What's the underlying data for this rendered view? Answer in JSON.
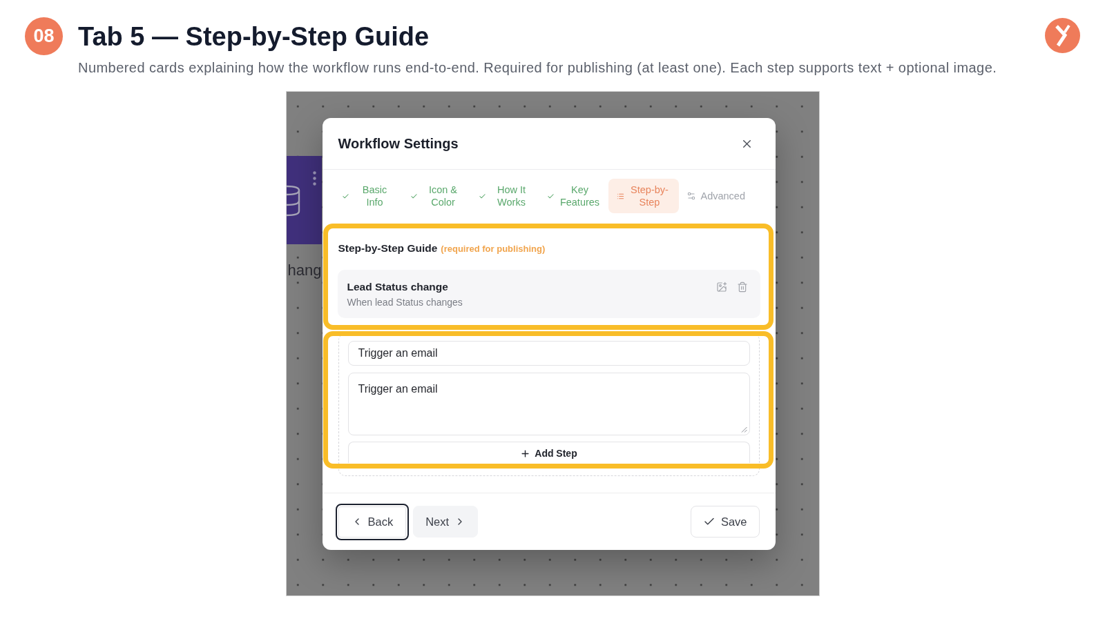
{
  "header": {
    "number": "08",
    "title": "Tab 5 — Step-by-Step Guide",
    "subtitle": "Numbered cards explaining how the workflow runs end-to-end. Required for publishing (at least one). Each step supports text + optional image."
  },
  "canvas": {
    "node_label": "hang"
  },
  "dialog": {
    "title": "Workflow Settings",
    "tabs": [
      {
        "label": "Basic Info",
        "kind": "done",
        "selected": false
      },
      {
        "label": "Icon & Color",
        "kind": "done",
        "selected": false
      },
      {
        "label": "How It Works",
        "kind": "done",
        "selected": false
      },
      {
        "label": "Key Features",
        "kind": "done",
        "selected": false
      },
      {
        "label": "Step-by-Step",
        "kind": "steps",
        "selected": true
      },
      {
        "label": "Advanced",
        "kind": "advanced",
        "selected": false
      }
    ],
    "section": {
      "title": "Step-by-Step Guide",
      "note": "(required for publishing)"
    },
    "steps": [
      {
        "title": "Lead Status change",
        "description": "When lead Status changes"
      }
    ],
    "editor": {
      "title_field": {
        "value": "Trigger an email"
      },
      "description_field": {
        "value": "Trigger an email"
      },
      "add_button": "Add Step"
    },
    "footer_buttons": [
      {
        "label": "Back",
        "kind": "back",
        "focused": true
      },
      {
        "label": "Next",
        "kind": "next",
        "focused": false
      },
      {
        "label": "Save",
        "kind": "save",
        "focused": false
      }
    ]
  }
}
